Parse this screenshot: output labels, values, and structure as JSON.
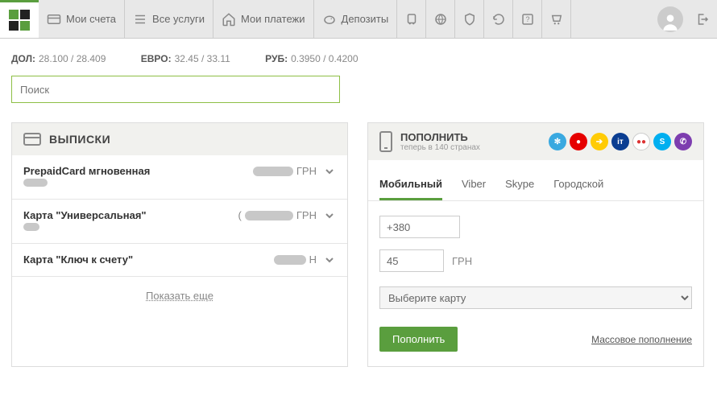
{
  "nav": {
    "accounts": "Мои счета",
    "services": "Все услуги",
    "payments": "Мои платежи",
    "deposits": "Депозиты"
  },
  "rates": {
    "usd_label": "ДОЛ:",
    "usd": "28.100 / 28.409",
    "eur_label": "ЕВРО:",
    "eur": "32.45 / 33.11",
    "rub_label": "РУБ:",
    "rub": "0.3950 / 0.4200"
  },
  "search": {
    "placeholder": "Поиск"
  },
  "statements": {
    "title": "ВЫПИСКИ",
    "items": [
      {
        "name": "PrepaidCard мгновенная",
        "currency": "ГРН"
      },
      {
        "name": "Карта \"Универсальная\"",
        "currency": "ГРН"
      },
      {
        "name": "Карта \"Ключ к счету\"",
        "currency": "Н"
      }
    ],
    "show_more": "Показать еще"
  },
  "topup": {
    "title": "ПОПОЛНИТЬ",
    "subtitle": "теперь в 140 странах",
    "tabs": [
      "Мобильный",
      "Viber",
      "Skype",
      "Городской"
    ],
    "phone_value": "+380",
    "amount_value": "45",
    "amount_currency": "ГРН",
    "card_placeholder": "Выберите карту",
    "submit": "Пополнить",
    "mass": "Массовое пополнение",
    "operators": [
      {
        "name": "kyivstar",
        "bg": "#3aa9e0",
        "label": "✻"
      },
      {
        "name": "vodafone",
        "bg": "#e60000",
        "label": "●"
      },
      {
        "name": "lifecell",
        "bg": "#ffcb05",
        "label": "➔"
      },
      {
        "name": "intertelecom",
        "bg": "#0a3d91",
        "label": "iт"
      },
      {
        "name": "peoplenet",
        "bg": "#ffffff",
        "label": "●●"
      },
      {
        "name": "skype",
        "bg": "#00aff0",
        "label": "S"
      },
      {
        "name": "viber",
        "bg": "#7d3daf",
        "label": "✆"
      }
    ]
  }
}
